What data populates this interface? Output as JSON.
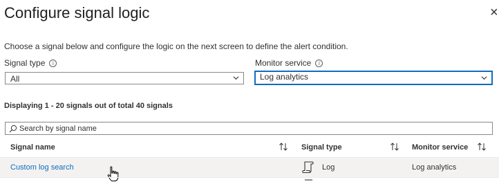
{
  "header": {
    "title": "Configure signal logic",
    "close_glyph": "×"
  },
  "description": "Choose a signal below and configure the logic on the next screen to define the alert condition.",
  "filters": {
    "signal_type": {
      "label": "Signal type",
      "value": "All",
      "info_icon": "info-icon"
    },
    "monitor_service": {
      "label": "Monitor service",
      "value": "Log analytics",
      "info_icon": "info-icon"
    }
  },
  "count_text": "Displaying 1 - 20 signals out of total 40 signals",
  "search": {
    "placeholder": "Search by signal name",
    "icon": "search-icon"
  },
  "table": {
    "columns": [
      "Signal name",
      "Signal type",
      "Monitor service"
    ],
    "rows": [
      {
        "name": "Custom log search",
        "type": "Log",
        "type_icon": "log-scroll-icon",
        "service": "Log analytics"
      }
    ]
  },
  "colors": {
    "accent": "#0f6cbd",
    "row_hover": "#f3f2f1",
    "text": "#323130"
  }
}
